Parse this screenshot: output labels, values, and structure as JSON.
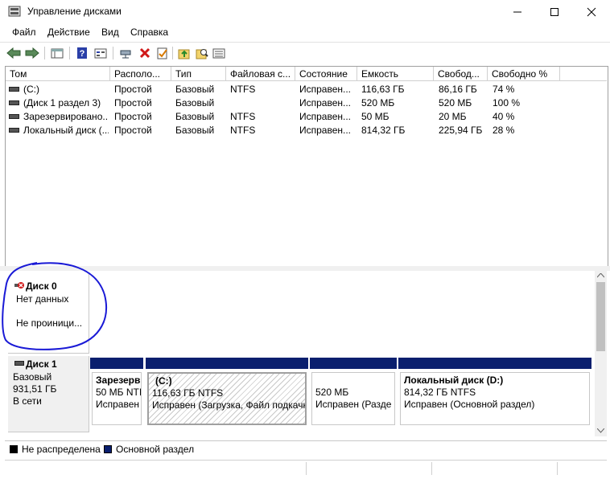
{
  "window": {
    "title": "Управление дисками"
  },
  "menu": [
    "Файл",
    "Действие",
    "Вид",
    "Справка"
  ],
  "toolbar_icons": [
    "back-arrow-icon",
    "forward-arrow-icon",
    "console-tree-icon",
    "help-icon",
    "view-icon",
    "connect-icon",
    "delete-icon",
    "properties-icon",
    "up-folder-icon",
    "search-icon",
    "view-list-icon"
  ],
  "columns": [
    "Том",
    "Располо...",
    "Тип",
    "Файловая с...",
    "Состояние",
    "Емкость",
    "Свобод...",
    "Свободно %"
  ],
  "volumes": [
    {
      "name": "(C:)",
      "layout": "Простой",
      "type": "Базовый",
      "fs": "NTFS",
      "status": "Исправен...",
      "capacity": "116,63 ГБ",
      "free": "86,16 ГБ",
      "free_pct": "74 %"
    },
    {
      "name": "(Диск 1 раздел 3)",
      "layout": "Простой",
      "type": "Базовый",
      "fs": "",
      "status": "Исправен...",
      "capacity": "520 МБ",
      "free": "520 МБ",
      "free_pct": "100 %"
    },
    {
      "name": "Зарезервировано...",
      "layout": "Простой",
      "type": "Базовый",
      "fs": "NTFS",
      "status": "Исправен...",
      "capacity": "50 МБ",
      "free": "20 МБ",
      "free_pct": "40 %"
    },
    {
      "name": "Локальный диск (...",
      "layout": "Простой",
      "type": "Базовый",
      "fs": "NTFS",
      "status": "Исправен...",
      "capacity": "814,32 ГБ",
      "free": "225,94 ГБ",
      "free_pct": "28 %"
    }
  ],
  "disk0": {
    "name": "Диск 0",
    "line1": "Нет данных",
    "line2": "Не проиници..."
  },
  "disk1": {
    "name": "Диск 1",
    "type": "Базовый",
    "size": "931,51 ГБ",
    "state": "В сети"
  },
  "partitions": [
    {
      "title": "Зарезерв",
      "line1": "50 МБ NTI",
      "line2": "Исправен"
    },
    {
      "title": "(C:)",
      "line1": "116,63 ГБ NTFS",
      "line2": "Исправен (Загрузка, Файл подкачк"
    },
    {
      "title": "",
      "line1": "520 МБ",
      "line2": "Исправен (Разде"
    },
    {
      "title": "Локальный диск  (D:)",
      "line1": "814,32 ГБ NTFS",
      "line2": "Исправен (Основной раздел)"
    }
  ],
  "legend": {
    "unallocated": "Не распределена",
    "primary": "Основной раздел"
  },
  "colors": {
    "primary": "#0a1f6e",
    "unallocated": "#000000",
    "annotation": "#1a1ad6"
  }
}
